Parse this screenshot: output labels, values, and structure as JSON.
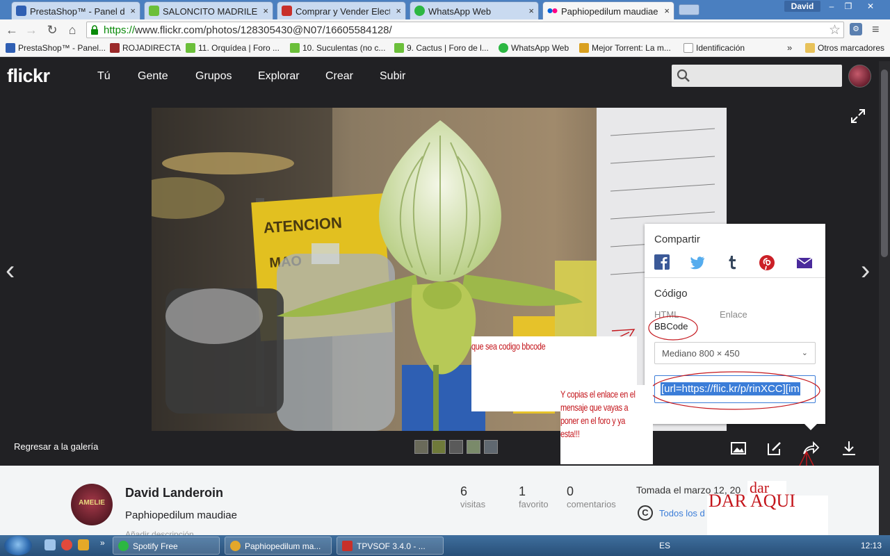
{
  "browser": {
    "tabs": [
      {
        "label": "PrestaShop™ - Panel de ac",
        "icon_color": "#2f5fb3"
      },
      {
        "label": "SALONCITO MADRILEÑO",
        "icon_color": "#6bbf3a"
      },
      {
        "label": "Comprar y Vender Electró",
        "icon_color": "#c8302a"
      },
      {
        "label": "WhatsApp Web",
        "icon_color": "#2cb742"
      },
      {
        "label": "Paphiopedilum maudiae |",
        "icon_color": "#ff0084"
      }
    ],
    "close_glyph": "×",
    "user": "David",
    "window_controls": [
      "–",
      "❐",
      "✕"
    ],
    "url_green": "https://",
    "url_rest": "www.flickr.com/photos/128305430@N07/16605584128/",
    "bookmarks": [
      {
        "label": "PrestaShop™ - Panel...",
        "icon_color": "#2f5fb3"
      },
      {
        "label": "ROJADIRECTA",
        "icon_color": "#9b2a2a"
      },
      {
        "label": "11. Orquídea | Foro ...",
        "icon_color": "#6bbf3a"
      },
      {
        "label": "10. Suculentas (no c...",
        "icon_color": "#6bbf3a"
      },
      {
        "label": "9. Cactus | Foro de l...",
        "icon_color": "#6bbf3a"
      },
      {
        "label": "WhatsApp Web",
        "icon_color": "#2cb742"
      },
      {
        "label": "Mejor Torrent: La m...",
        "icon_color": "#d9a020"
      },
      {
        "label": "Identificación",
        "icon_color": "#dddddd"
      }
    ],
    "bookmarks_more": "»",
    "other_bookmarks": "Otros marcadores"
  },
  "flickr": {
    "logo": "flickr",
    "nav": [
      "Tú",
      "Gente",
      "Grupos",
      "Explorar",
      "Crear",
      "Subir"
    ],
    "back_to_gallery": "Regresar a la galería",
    "thumbnail_count": 5
  },
  "share": {
    "title": "Compartir",
    "networks": [
      "facebook-icon",
      "twitter-icon",
      "tumblr-icon",
      "pinterest-icon",
      "email-icon"
    ],
    "code_title": "Código",
    "code_tabs": {
      "html": "HTML",
      "link": "Enlace",
      "bbcode": "BBCode"
    },
    "size_option": "Mediano 800 × 450",
    "code_value": "[url=https://flic.kr/p/rinXCC][im"
  },
  "annotations": {
    "bbcode_note": "que sea codigo bbcode",
    "copy_note": [
      "Y copias el enlace en el",
      "mensaje que vayas a",
      "poner en el foro y ya",
      "esta!!!"
    ],
    "dar_small": "dar",
    "dar_aqui": "DAR AQUI"
  },
  "photo_info": {
    "owner": "David Landeroin",
    "avatar_text": "AMELIE",
    "title": "Paphiopedilum maudiae",
    "add_description": "Añadir descripción",
    "stats": [
      {
        "num": "6",
        "label": "visitas"
      },
      {
        "num": "1",
        "label": "favorito"
      },
      {
        "num": "0",
        "label": "comentarios"
      }
    ],
    "taken": "Tomada el marzo 12, 20",
    "license": "Todos los d"
  },
  "taskbar": {
    "items": [
      {
        "label": "Spotify Free",
        "icon_color": "#2cb742"
      },
      {
        "label": "Paphiopedilum ma...",
        "icon_color": "#e2a72b"
      },
      {
        "label": "TPVSOF 3.4.0   - ...",
        "icon_color": "#c8302a"
      }
    ],
    "lang": "ES",
    "clock": "12:13"
  }
}
